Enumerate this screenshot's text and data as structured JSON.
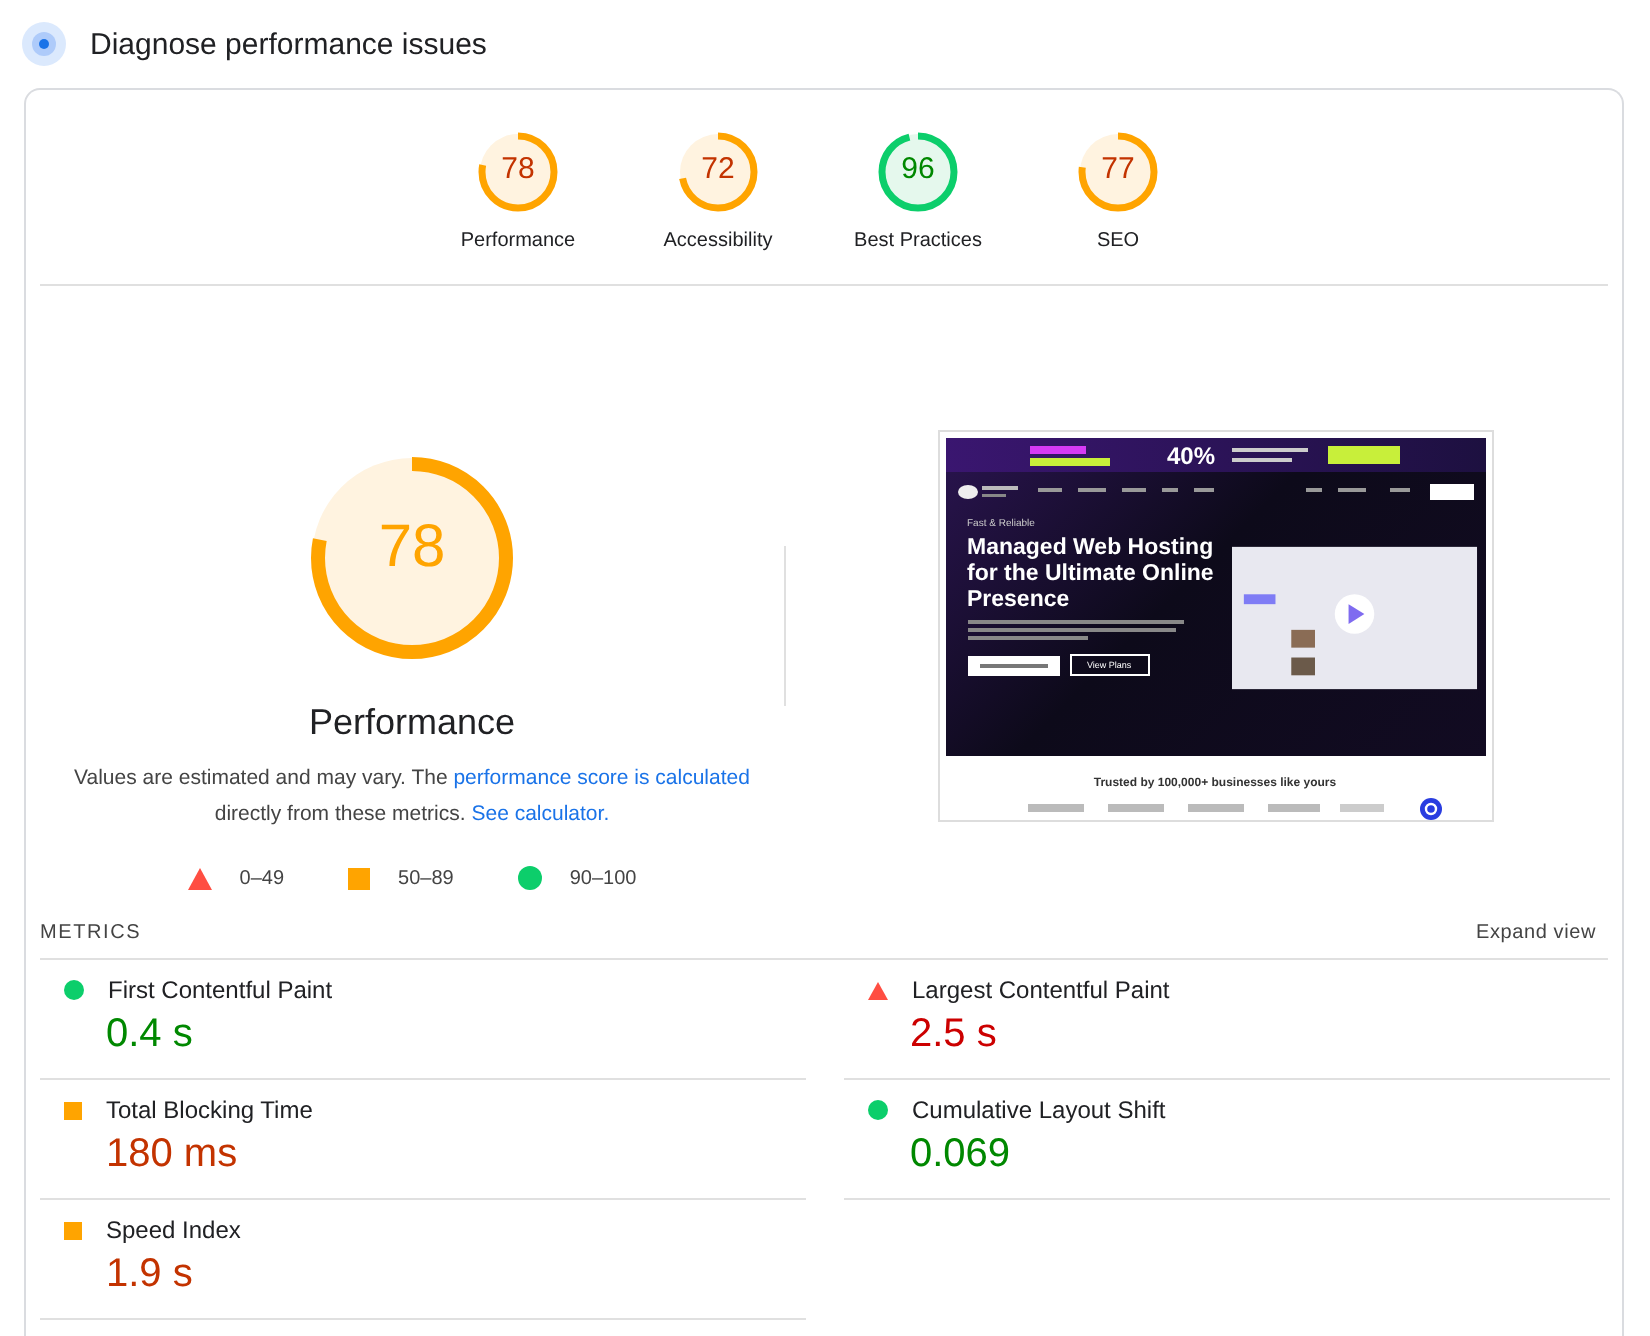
{
  "header": {
    "title": "Diagnose performance issues"
  },
  "categories": [
    {
      "label": "Performance",
      "score": "78",
      "level": 0.78
    },
    {
      "label": "Accessibility",
      "score": "72",
      "level": 0.72
    },
    {
      "label": "Best Practices",
      "score": "96",
      "level": 0.96
    },
    {
      "label": "SEO",
      "score": "77",
      "level": 0.77
    }
  ],
  "main_gauge": {
    "score": "78",
    "level": 0.78,
    "label": "Performance"
  },
  "description": {
    "text": "Values are estimated and may vary. The ",
    "link1": "performance score is calculated",
    "middle": " directly from these metrics. ",
    "link2": "See calculator."
  },
  "legend": [
    {
      "kind": "fail",
      "label": "0–49"
    },
    {
      "kind": "average",
      "label": "50–89"
    },
    {
      "kind": "good",
      "label": "90–100"
    }
  ],
  "thumbnail": {
    "banner": "40%",
    "tagline": "Fast & Reliable",
    "headline": "Managed Web Hosting for the Ultimate Online Presence",
    "button": "View Plans",
    "trust": "Trusted by 100,000+ businesses like yours"
  },
  "metrics_heading": "METRICS",
  "expand": "Expand view",
  "metrics": [
    {
      "label": "First Contentful Paint",
      "value": "0.4 s",
      "kind": "good"
    },
    {
      "label": "Largest Contentful Paint",
      "value": "2.5 s",
      "kind": "fail"
    },
    {
      "label": "Total Blocking Time",
      "value": "180 ms",
      "kind": "average"
    },
    {
      "label": "Cumulative Layout Shift",
      "value": "0.069",
      "kind": "good"
    },
    {
      "label": "Speed Index",
      "value": "1.9 s",
      "kind": "average"
    }
  ]
}
